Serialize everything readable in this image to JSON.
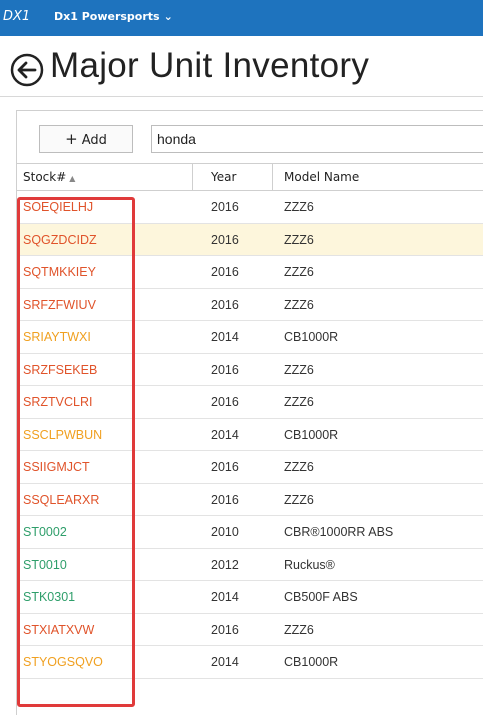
{
  "topbar": {
    "logo": "DX1",
    "app_name": "Dx1 Powersports"
  },
  "page": {
    "title": "Major Unit Inventory"
  },
  "toolbar": {
    "add_label": "Add",
    "search_value": "honda"
  },
  "columns": {
    "stock": "Stock#",
    "year": "Year",
    "model": "Model Name"
  },
  "colors": {
    "topbar": "#1e73be",
    "highlight": "#e03a3a",
    "selected_row": "#fdf6dc",
    "stock_red": "#e0532a",
    "stock_orange": "#f0a020",
    "stock_green": "#2e9e6a"
  },
  "rows": [
    {
      "stock": "SOEQIELHJ",
      "year": "2016",
      "model": "ZZZ6",
      "color": "orange-red"
    },
    {
      "stock": "SQGZDCIDZ",
      "year": "2016",
      "model": "ZZZ6",
      "color": "orange-red"
    },
    {
      "stock": "SQTMKKIEY",
      "year": "2016",
      "model": "ZZZ6",
      "color": "orange-red"
    },
    {
      "stock": "SRFZFWIUV",
      "year": "2016",
      "model": "ZZZ6",
      "color": "orange-red"
    },
    {
      "stock": "SRIAYTWXI",
      "year": "2014",
      "model": "CB1000R",
      "color": "orange"
    },
    {
      "stock": "SRZFSEKEB",
      "year": "2016",
      "model": "ZZZ6",
      "color": "orange-red"
    },
    {
      "stock": "SRZTVCLRI",
      "year": "2016",
      "model": "ZZZ6",
      "color": "orange-red"
    },
    {
      "stock": "SSCLPWBUN",
      "year": "2014",
      "model": "CB1000R",
      "color": "orange"
    },
    {
      "stock": "SSIIGMJCT",
      "year": "2016",
      "model": "ZZZ6",
      "color": "orange-red"
    },
    {
      "stock": "SSQLEARXR",
      "year": "2016",
      "model": "ZZZ6",
      "color": "orange-red"
    },
    {
      "stock": "ST0002",
      "year": "2010",
      "model": "CBR®1000RR ABS",
      "color": "green"
    },
    {
      "stock": "ST0010",
      "year": "2012",
      "model": "Ruckus®",
      "color": "green"
    },
    {
      "stock": "STK0301",
      "year": "2014",
      "model": "CB500F ABS",
      "color": "green"
    },
    {
      "stock": "STXIATXVW",
      "year": "2016",
      "model": "ZZZ6",
      "color": "orange-red"
    },
    {
      "stock": "STYOGSQVO",
      "year": "2014",
      "model": "CB1000R",
      "color": "orange"
    }
  ]
}
